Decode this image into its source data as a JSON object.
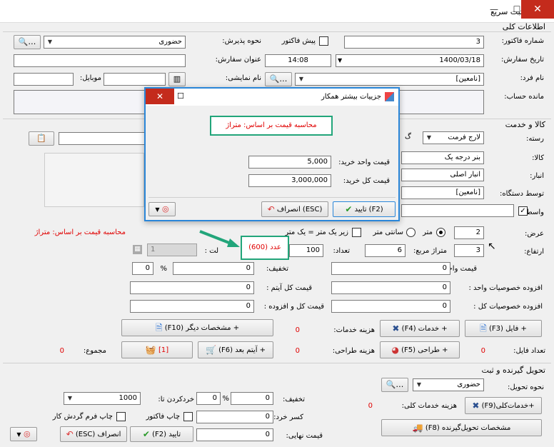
{
  "window": {
    "title": "ثبت سریع",
    "close": "✕",
    "max": "☐",
    "min": "—"
  },
  "general": {
    "section": "اطلاعات کلی",
    "invoice_no_label": "شماره فاکتور:",
    "invoice_no": "3",
    "pre_invoice_label": "پیش فاکتور",
    "reception_label": "نحوه پذیرش:",
    "reception": "حضوری",
    "order_date_label": "تاریخ سفارش:",
    "order_date": "1400/03/18",
    "order_time": "14:08",
    "order_title_label": "عنوان سفارش:",
    "person_label": "نام فرد:",
    "person": "[نامعین]",
    "display_name_label": "نام نمایشی:",
    "mobile_label": "موبایل:",
    "balance_label": "مانده حساب:",
    "ellipsis": "..."
  },
  "goods": {
    "section": "کالا و خدمت",
    "category_label": "رسته:",
    "category": "لارج فرمت",
    "category_g": "گ",
    "item_label": "کالا:",
    "item": "بنر درجه یک",
    "warehouse_label": "انبار:",
    "warehouse": "انبار اصلی",
    "machine_label": "توسط دستگاه:",
    "machine": "[نامعین]",
    "broker_label": "واسط:",
    "calc_basis": "محاسبه قیمت بر اساس: متراژ",
    "width_label": "عرض:",
    "width": "2",
    "unit_meter": "متر",
    "unit_cm": "سانتی متر",
    "under_one": "زیر یک متر = یک متر",
    "height_label": "ارتفاع:",
    "height": "3",
    "sqm_label": "متراژ مربع:",
    "sqm": "6",
    "qty_label": "تعداد:",
    "qty": "100",
    "qty_units": "عدد (600)",
    "lot_label": "لت :",
    "lot": "1",
    "unit_price_label": "قیمت واحد :",
    "unit_price": "0",
    "discount_label": "تخفیف:",
    "discount": "0",
    "discount_pct": "0",
    "pct": "%",
    "unit_extra_label": "افزوده خصوصیات واحد :",
    "unit_extra": "0",
    "item_total_label": "قیمت کل آیتم :",
    "item_total": "0",
    "total_extra_label": "افزوده خصوصیات کل :",
    "total_extra": "0",
    "total_with_extra_label": "قیمت کل و افزوده :",
    "total_with_extra": "0",
    "file_btn": "+ فایل (F3)",
    "services_btn": "+ خدمات (F4)",
    "services_cost_label": "هزینه خدمات:",
    "services_cost": "0",
    "other_specs_btn": "+ مشخصات دیگر (F10)",
    "files_count_label": "تعداد فایل:",
    "files_count": "0",
    "design_btn": "+ طراحی (F5)",
    "design_cost_label": "هزینه طراحی:",
    "design_cost": "0",
    "next_item_btn": "+ آیتم بعد (F6)",
    "cart_count": "[1]",
    "sum_label": "مجموع:",
    "sum": "0"
  },
  "delivery": {
    "section": "تحویل گیرنده و ثبت",
    "method_label": "نحوه تحویل:",
    "method": "حضوری",
    "general_services_btn": "+خدمات‌کلی(F9)",
    "general_services_label": "هزینه خدمات کلی:",
    "general_services": "0",
    "receiver_btn": "مشخصات تحویل‌گیرنده (F8)",
    "discount_label": "تخفیف:",
    "discount": "0",
    "discount_pct": "0",
    "pct": "%",
    "round_label": "خردکردن تا:",
    "round": "1000",
    "deduction_label": "کسر خرد:",
    "deduction": "0",
    "print_invoice": "چاپ فاکتور",
    "print_flow": "چاپ فرم گردش کار",
    "final_label": "قیمت نهایی:",
    "final": "0",
    "confirm_btn": "تایید (F2)",
    "cancel_btn": "انصراف (ESC)"
  },
  "dialog": {
    "title": "جزییات بیشتر همکار",
    "calc_basis": "محاسبه قیمت بر اساس: متراژ",
    "unit_buy_label": "قیمت واحد خرید:",
    "unit_buy": "5,000",
    "total_buy_label": "قیمت کل خرید:",
    "total_buy": "3,000,000",
    "confirm_btn": "(F2) تایید",
    "cancel_btn": "(ESC) انصراف"
  }
}
